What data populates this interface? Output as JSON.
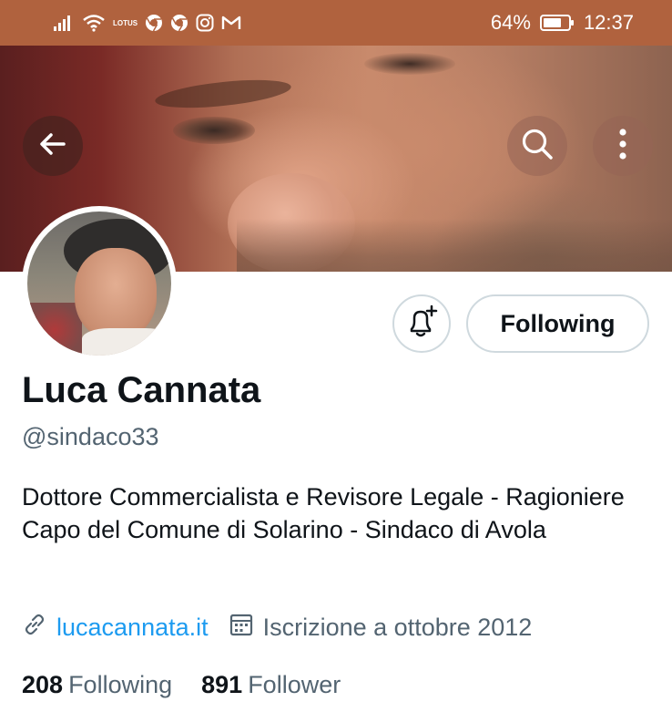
{
  "status_bar": {
    "battery_percent": "64%",
    "time": "12:37",
    "carrier_badge": "LOTUS",
    "icons": [
      "signal-icon",
      "wifi-icon",
      "carrier-icon",
      "chrome-icon",
      "chrome-icon",
      "instagram-icon",
      "gmail-icon",
      "battery-icon"
    ]
  },
  "header": {
    "back_icon": "arrow-left-icon",
    "search_icon": "search-icon",
    "more_icon": "more-vertical-icon"
  },
  "actions": {
    "notify_icon": "bell-plus-icon",
    "follow_label": "Following"
  },
  "profile": {
    "name": "Luca Cannata",
    "handle": "@sindaco33",
    "bio": "Dottore Commercialista e Revisore Legale - Ragioniere Capo del Comune di Solarino - Sindaco di Avola",
    "website": "lucacannata.it",
    "joined": "Iscrizione a ottobre 2012"
  },
  "stats": {
    "following_count": "208",
    "following_label": "Following",
    "followers_count": "891",
    "followers_label": "Follower"
  },
  "colors": {
    "status_bar": "#b0623e",
    "link": "#1d9bf0",
    "secondary_text": "#536471",
    "border": "#cfd9de"
  }
}
